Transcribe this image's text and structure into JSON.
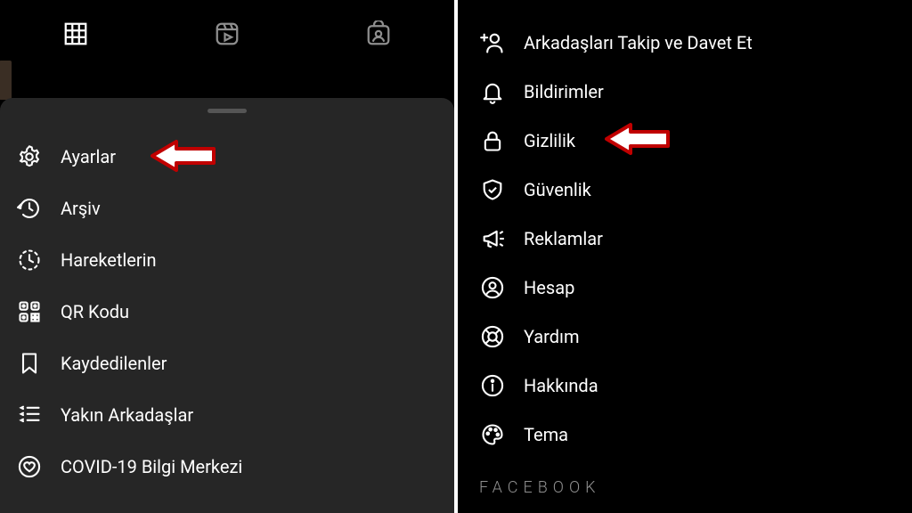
{
  "left": {
    "menu": [
      {
        "label": "Ayarlar",
        "arrow": true
      },
      {
        "label": "Arşiv"
      },
      {
        "label": "Hareketlerin"
      },
      {
        "label": "QR Kodu"
      },
      {
        "label": "Kaydedilenler"
      },
      {
        "label": "Yakın Arkadaşlar"
      },
      {
        "label": "COVID-19 Bilgi Merkezi"
      }
    ]
  },
  "right": {
    "settings": [
      {
        "label": "Arkadaşları Takip ve Davet Et"
      },
      {
        "label": "Bildirimler"
      },
      {
        "label": "Gizlilik",
        "arrow": true
      },
      {
        "label": "Güvenlik"
      },
      {
        "label": "Reklamlar"
      },
      {
        "label": "Hesap"
      },
      {
        "label": "Yardım"
      },
      {
        "label": "Hakkında"
      },
      {
        "label": "Tema"
      }
    ],
    "footer": "FACEBOOK"
  }
}
